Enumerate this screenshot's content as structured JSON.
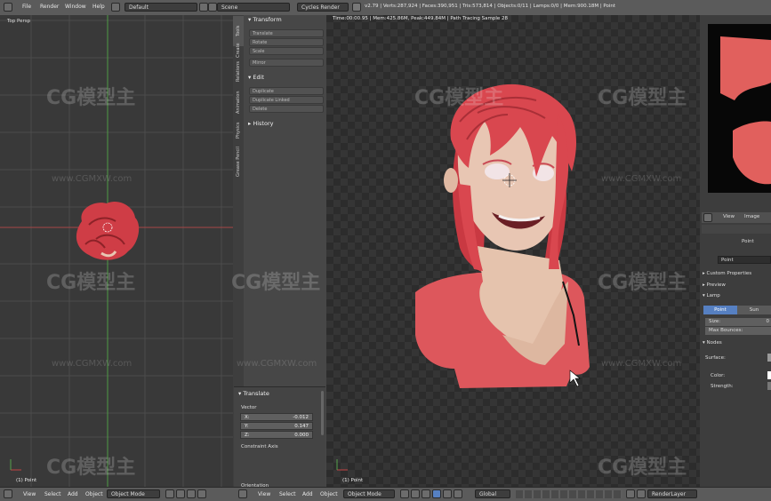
{
  "menus": [
    "File",
    "Render",
    "Window",
    "Help"
  ],
  "screen_layout": "Default",
  "scene_name": "Scene",
  "render_engine": "Cycles Render",
  "stats": "v2.79 | Verts:287,924 | Faces:390,951 | Tris:573,814 | Objects:0/11 | Lamps:0/0 | Mem:900.18M | Point",
  "left_viewport": {
    "label": "Top Persp",
    "object_label": "(1) Point"
  },
  "tool_tabs": [
    "Tools",
    "Create",
    "Relations",
    "Animation",
    "Physics",
    "Grease Pencil"
  ],
  "transform_panel": {
    "title": "Transform",
    "buttons": [
      "Translate",
      "Rotate",
      "Scale",
      "Mirror"
    ]
  },
  "edit_panel": {
    "title": "Edit",
    "buttons": [
      "Duplicate",
      "Duplicate Linked",
      "Delete"
    ]
  },
  "history_panel": {
    "title": "History"
  },
  "translate_op": {
    "title": "Translate",
    "vector_label": "Vector",
    "fields": [
      {
        "axis": "X:",
        "value": "-0.012"
      },
      {
        "axis": "Y:",
        "value": "0.147"
      },
      {
        "axis": "Z:",
        "value": "0.000"
      }
    ],
    "constraint_label": "Constraint Axis",
    "orientation_label": "Orientation"
  },
  "render_info": "Time:00:00.95 | Mem:425.86M, Peak:449.84M | Path Tracing Sample 28",
  "main_viewport": {
    "object_label": "(1) Point"
  },
  "properties": {
    "view_tab": "View",
    "image_tab": "Image",
    "object_name": "Point",
    "datablock_name": "Point",
    "sections": [
      "Custom Properties",
      "Preview",
      "Lamp"
    ],
    "lamp_types": [
      "Point",
      "Sun"
    ],
    "size_label": "Size:",
    "size_value": "0",
    "max_bounces_label": "Max Bounces:",
    "nodes_section": "Nodes",
    "surface_label": "Surface:",
    "color_label": "Color:",
    "strength_label": "Strength:"
  },
  "bottom_left": {
    "items": [
      "View",
      "Select",
      "Add",
      "Object"
    ],
    "mode": "Object Mode"
  },
  "bottom_main": {
    "items": [
      "View",
      "Select",
      "Add",
      "Object"
    ],
    "mode": "Object Mode",
    "orientation": "Global",
    "render_layer": "RenderLayer"
  },
  "watermark": {
    "brand": "CG模型主",
    "url": "www.CGMXW.com"
  },
  "colors": {
    "hair": "#d9474f",
    "skin": "#e8c6b3",
    "shirt": "#e0575c",
    "x_axis": "#b84545",
    "y_axis": "#5ea84e",
    "active_tab": "#5680c2"
  }
}
